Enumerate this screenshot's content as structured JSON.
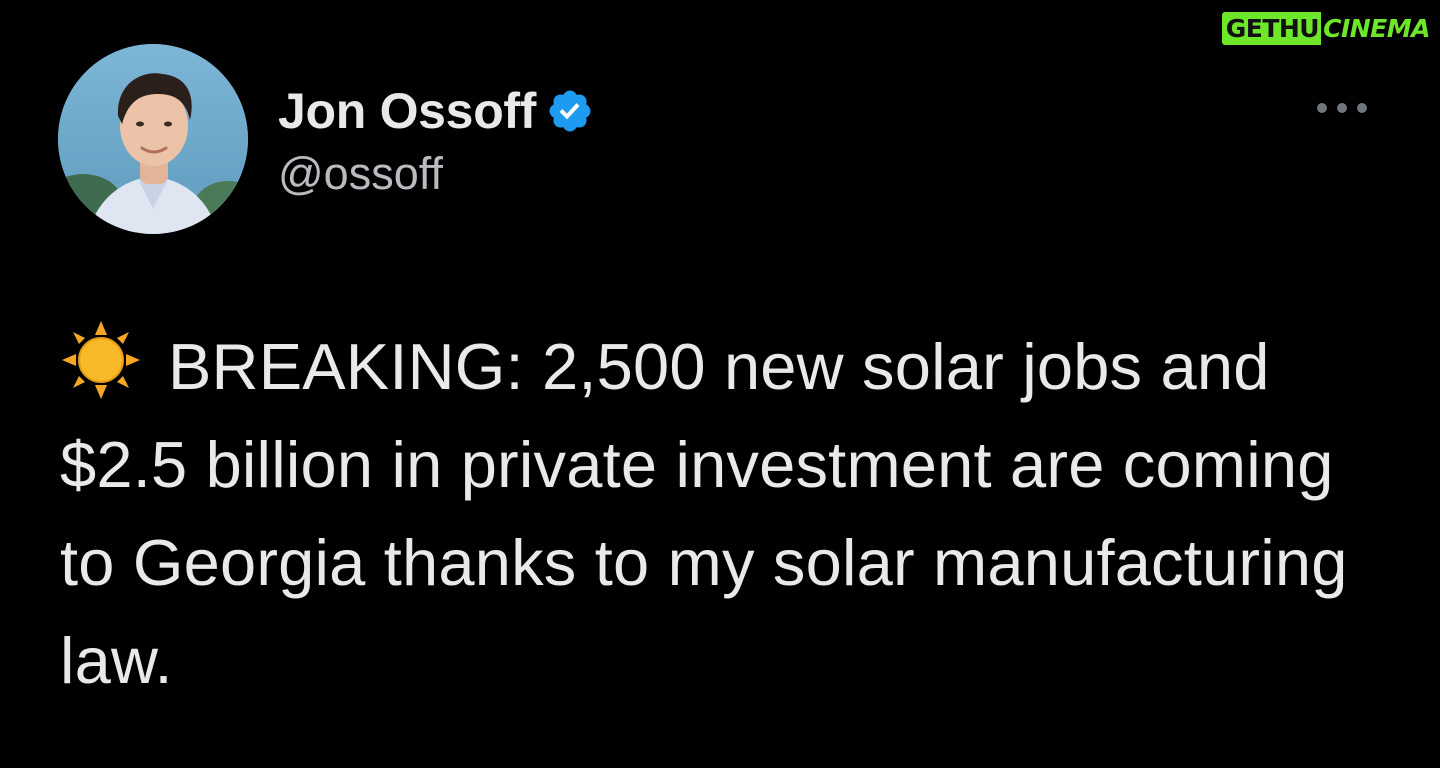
{
  "watermark": {
    "left": "GETHU",
    "right": "CINEMA",
    "color": "#6ee62a"
  },
  "tweet": {
    "author": {
      "display_name": "Jon Ossoff",
      "handle": "@ossoff",
      "verified": true,
      "verified_icon": "verified-badge-icon",
      "verified_color": "#1d9bf0"
    },
    "more_icon": "more-options-icon",
    "emoji": "☀️",
    "text": "BREAKING: 2,500 new solar jobs and $2.5 billion in private investment are coming to Georgia thanks to my solar manufacturing law."
  },
  "theme": {
    "background": "#000000",
    "text": "#e7e9ea",
    "secondary_text": "#b8bcc0"
  }
}
